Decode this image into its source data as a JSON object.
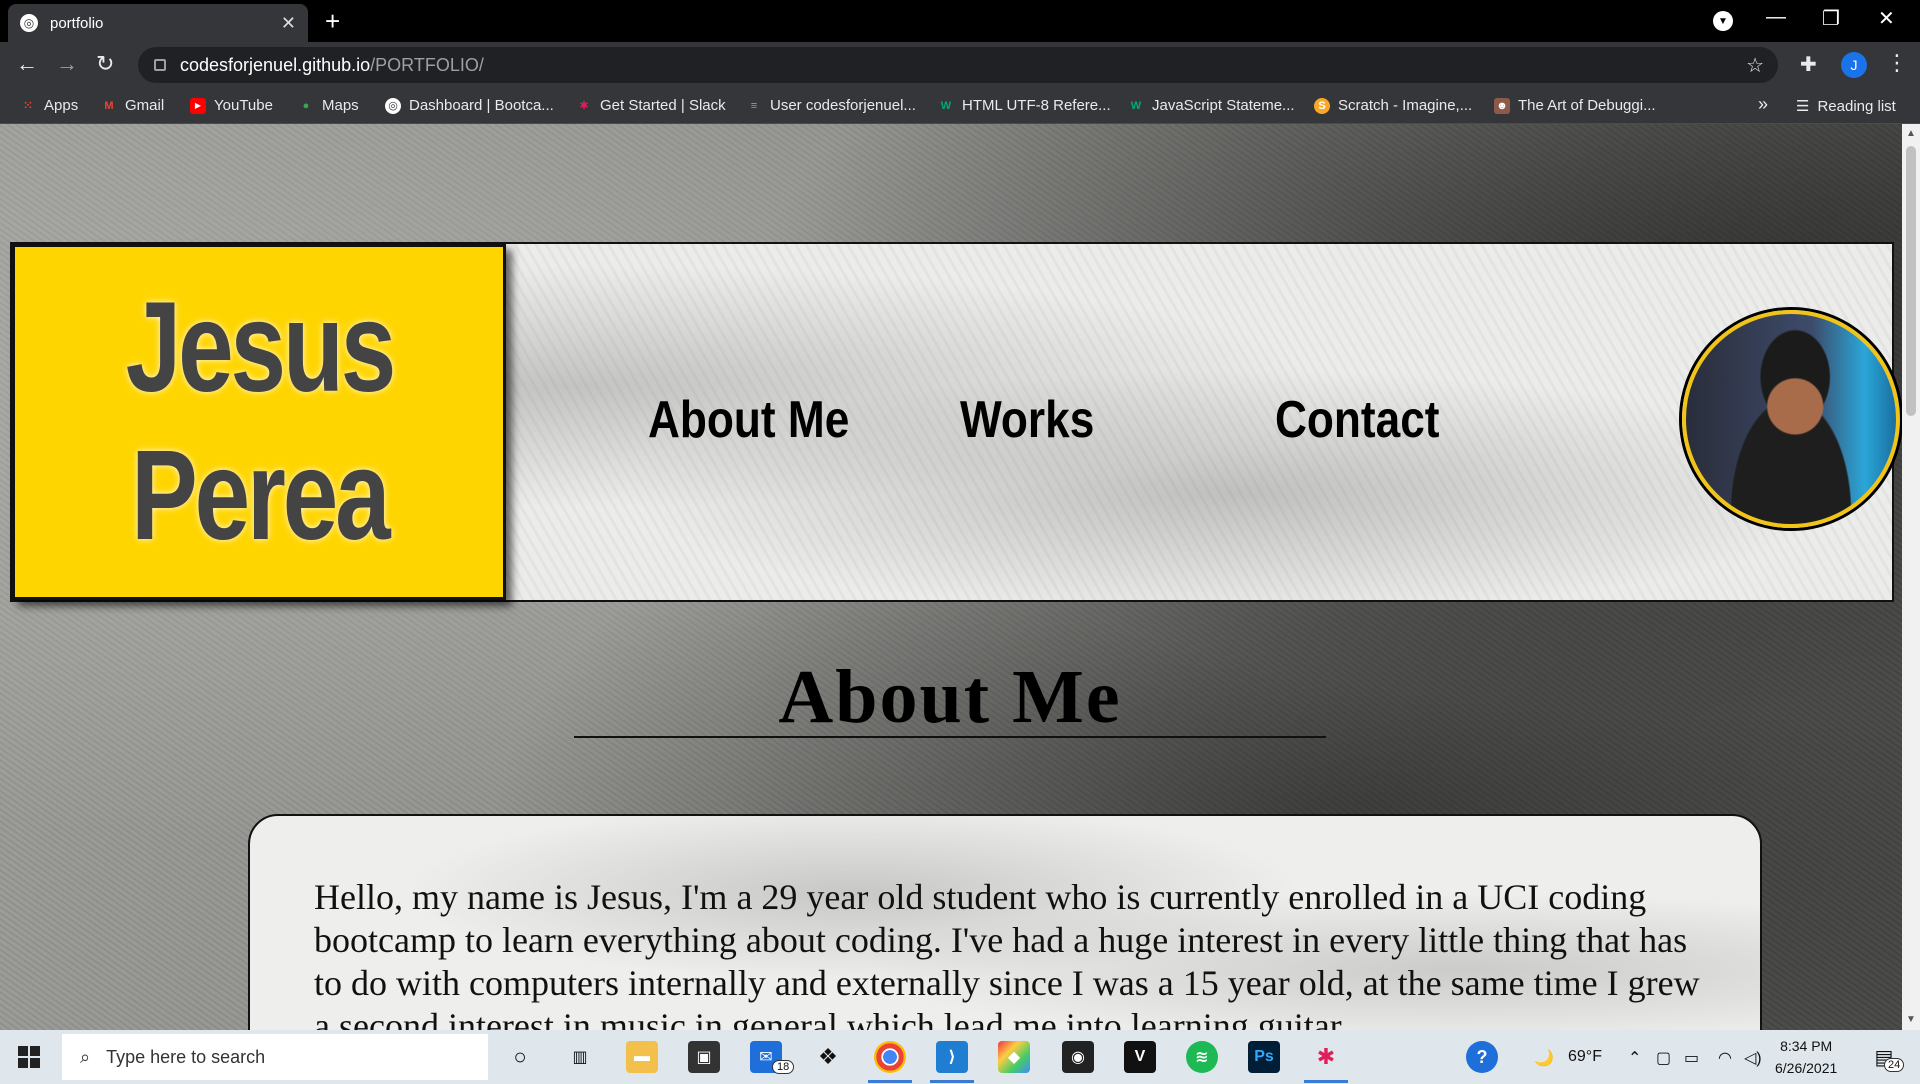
{
  "browser": {
    "tab_title": "portfolio",
    "url_host": "codesforjenuel.github.io",
    "url_path": "/PORTFOLIO/",
    "profile_initial": "J",
    "bookmarks": [
      {
        "label": "Apps",
        "icon": "apps-grid-icon"
      },
      {
        "label": "Gmail",
        "icon": "gmail-icon"
      },
      {
        "label": "YouTube",
        "icon": "youtube-icon"
      },
      {
        "label": "Maps",
        "icon": "maps-icon"
      },
      {
        "label": "Dashboard | Bootca...",
        "icon": "globe-icon"
      },
      {
        "label": "Get Started | Slack",
        "icon": "slack-icon"
      },
      {
        "label": "User codesforjenuel...",
        "icon": "stackoverflow-icon"
      },
      {
        "label": "HTML UTF-8 Refere...",
        "icon": "w3schools-icon"
      },
      {
        "label": "JavaScript Stateme...",
        "icon": "w3schools-icon"
      },
      {
        "label": "Scratch - Imagine,...",
        "icon": "scratch-icon"
      },
      {
        "label": "The Art of Debuggi...",
        "icon": "person-icon"
      }
    ],
    "more_bookmarks": "»",
    "reading_list": "Reading list"
  },
  "site": {
    "name_first": "Jesus",
    "name_last": "Perea",
    "nav": [
      "About Me",
      "Works",
      "Contact"
    ],
    "section_title": "About Me",
    "about_text": "Hello, my name is Jesus, I'm a 29 year old student who is currently enrolled in a UCI coding bootcamp to learn everything about coding. I've had a huge interest in every little thing that has to do with computers internally and externally since I was a 15 year old, at the same time I grew a second interest in music in general which lead me into learning guitar."
  },
  "taskbar": {
    "search_placeholder": "Type here to search",
    "mail_badge": "18",
    "weather": "69°F",
    "time": "8:34 PM",
    "date": "6/26/2021",
    "notifications": "24"
  },
  "colors": {
    "name_box": "#ffd500",
    "name_text": "#444444",
    "profile_ring": "#f0c419"
  }
}
